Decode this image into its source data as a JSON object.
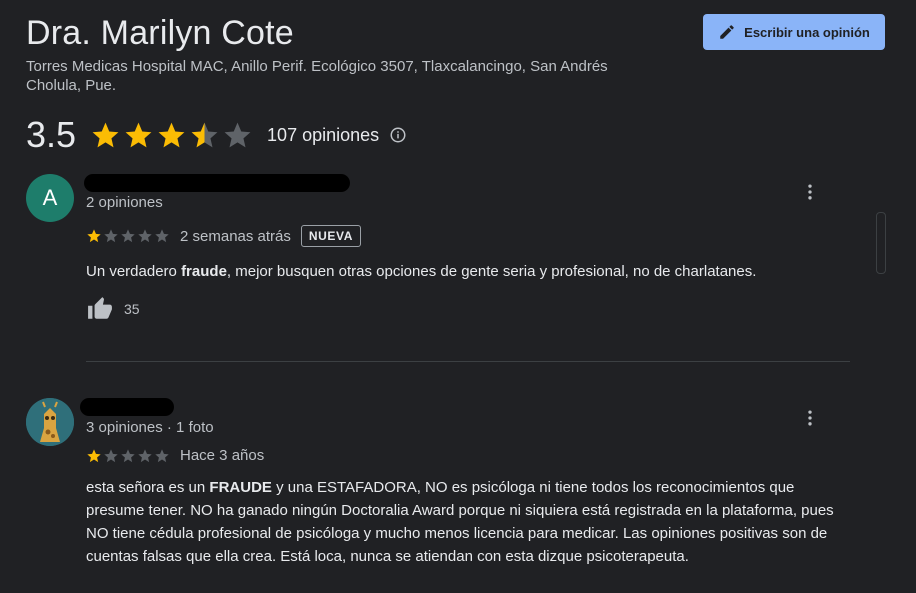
{
  "header": {
    "title": "Dra. Marilyn Cote",
    "address": "Torres Medicas Hospital MAC, Anillo Perif. Ecológico 3507, Tlaxcalancingo, San Andrés Cholula, Pue.",
    "write_button_label": "Escribir una opinión",
    "write_button_icon": "pencil-icon"
  },
  "summary": {
    "rating": "3.5",
    "rating_stars_value": 3.5,
    "review_count_label": "107 opiniones",
    "info_icon": "info-icon"
  },
  "colors": {
    "background": "#202124",
    "star_filled": "#fbbc04",
    "star_empty": "#5f6368",
    "button_bg": "#8ab4f8",
    "avatar_a": "#1e7d6b"
  },
  "reviews": [
    {
      "avatar_letter": "A",
      "meta": "2 opiniones",
      "stars": 1,
      "date": "2 semanas atrás",
      "badge": "NUEVA",
      "text_before": "Un verdadero ",
      "text_bold": "fraude",
      "text_after": ", mejor busquen otras opciones de gente seria y profesional, no de charlatanes.",
      "likes": "35"
    },
    {
      "avatar_letter": "",
      "meta": "3 opiniones · 1 foto",
      "stars": 1,
      "date": "Hace 3 años",
      "text_before": "esta señora es un ",
      "text_bold": "FRAUDE",
      "text_after": " y una ESTAFADORA, NO es psicóloga ni tiene todos los reconocimientos que presume tener. NO ha ganado ningún Doctoralia Award porque ni siquiera está registrada en la plataforma, pues NO tiene cédula profesional de psicóloga y mucho menos licencia para medicar. Las opiniones positivas son de cuentas falsas que ella crea. Está loca, nunca se atiendan con esta dizque psicoterapeuta."
    }
  ]
}
